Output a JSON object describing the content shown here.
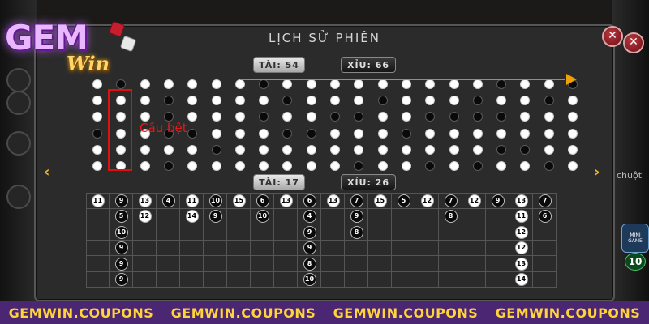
{
  "brand": {
    "logo_main": "GEM",
    "logo_sub": "Win"
  },
  "panel": {
    "title": "LỊCH SỬ PHIÊN",
    "close_label": "✕",
    "top_counts": {
      "tai_label": "TÀI:",
      "tai_value": "54",
      "xiu_label": "XỈU:",
      "xiu_value": "66"
    },
    "bottom_counts": {
      "tai_label": "TÀI:",
      "tai_value": "17",
      "xiu_label": "XỈU:",
      "xiu_value": "26"
    },
    "nav_prev": "‹",
    "nav_next": "›",
    "annotation": "Cầu bệt"
  },
  "dot_columns": [
    [
      "w",
      "w",
      "w",
      "b",
      "w",
      "w"
    ],
    [
      "b",
      "w",
      "w",
      "w",
      "w",
      "w"
    ],
    [
      "w",
      "w",
      "w",
      "w",
      "w",
      "w"
    ],
    [
      "w",
      "b",
      "b",
      "b",
      "w",
      "b"
    ],
    [
      "w",
      "w",
      "w",
      "b",
      "w",
      "w"
    ],
    [
      "w",
      "w",
      "w",
      "w",
      "b",
      "w"
    ],
    [
      "w",
      "w",
      "w",
      "w",
      "w",
      "w"
    ],
    [
      "b",
      "w",
      "b",
      "w",
      "w",
      "w"
    ],
    [
      "w",
      "b",
      "w",
      "b",
      "w",
      "w"
    ],
    [
      "w",
      "w",
      "w",
      "b",
      "w",
      "w"
    ],
    [
      "w",
      "w",
      "b",
      "w",
      "w",
      "w"
    ],
    [
      "w",
      "w",
      "b",
      "w",
      "w",
      "b"
    ],
    [
      "w",
      "b",
      "w",
      "w",
      "w",
      "w"
    ],
    [
      "w",
      "w",
      "w",
      "b",
      "w",
      "w"
    ],
    [
      "w",
      "w",
      "b",
      "w",
      "w",
      "b"
    ],
    [
      "w",
      "w",
      "b",
      "w",
      "w",
      "w"
    ],
    [
      "w",
      "b",
      "b",
      "w",
      "w",
      "b"
    ],
    [
      "b",
      "w",
      "b",
      "w",
      "b",
      "w"
    ],
    [
      "w",
      "w",
      "w",
      "w",
      "b",
      "w"
    ],
    [
      "w",
      "b",
      "w",
      "w",
      "w",
      "b"
    ],
    [
      "b",
      "w",
      "w",
      "w",
      "w",
      "w"
    ]
  ],
  "number_columns": [
    [
      {
        "v": "11",
        "c": "w"
      }
    ],
    [
      {
        "v": "9",
        "c": "b"
      },
      {
        "v": "5",
        "c": "b"
      },
      {
        "v": "10",
        "c": "b"
      },
      {
        "v": "9",
        "c": "b"
      },
      {
        "v": "9",
        "c": "b"
      },
      {
        "v": "9",
        "c": "b"
      }
    ],
    [
      {
        "v": "13",
        "c": "w"
      },
      {
        "v": "12",
        "c": "w"
      }
    ],
    [
      {
        "v": "4",
        "c": "b"
      }
    ],
    [
      {
        "v": "11",
        "c": "w"
      },
      {
        "v": "14",
        "c": "w"
      }
    ],
    [
      {
        "v": "10",
        "c": "b"
      },
      {
        "v": "9",
        "c": "b"
      }
    ],
    [
      {
        "v": "15",
        "c": "w"
      }
    ],
    [
      {
        "v": "6",
        "c": "b"
      },
      {
        "v": "10",
        "c": "b"
      }
    ],
    [
      {
        "v": "13",
        "c": "w"
      }
    ],
    [
      {
        "v": "6",
        "c": "b"
      },
      {
        "v": "4",
        "c": "b"
      },
      {
        "v": "9",
        "c": "b"
      },
      {
        "v": "9",
        "c": "b"
      },
      {
        "v": "8",
        "c": "b"
      },
      {
        "v": "10",
        "c": "b"
      }
    ],
    [
      {
        "v": "13",
        "c": "w"
      }
    ],
    [
      {
        "v": "7",
        "c": "b"
      },
      {
        "v": "9",
        "c": "b"
      },
      {
        "v": "8",
        "c": "b"
      }
    ],
    [
      {
        "v": "15",
        "c": "w"
      }
    ],
    [
      {
        "v": "5",
        "c": "b"
      }
    ],
    [
      {
        "v": "12",
        "c": "w"
      }
    ],
    [
      {
        "v": "7",
        "c": "b"
      },
      {
        "v": "8",
        "c": "b"
      }
    ],
    [
      {
        "v": "12",
        "c": "w"
      }
    ],
    [
      {
        "v": "9",
        "c": "b"
      }
    ],
    [
      {
        "v": "13",
        "c": "w"
      },
      {
        "v": "11",
        "c": "w"
      },
      {
        "v": "12",
        "c": "w"
      },
      {
        "v": "12",
        "c": "w"
      },
      {
        "v": "13",
        "c": "w"
      },
      {
        "v": "14",
        "c": "w"
      }
    ],
    [
      {
        "v": "7",
        "c": "b"
      },
      {
        "v": "6",
        "c": "b"
      }
    ]
  ],
  "side_text": "chuột",
  "mini_game": {
    "label": "MINI GAME",
    "count": "10"
  },
  "footer": [
    "GEMWIN.COUPONS",
    "GEMWIN.COUPONS",
    "GEMWIN.COUPONS",
    "GEMWIN.COUPONS"
  ],
  "colors": {
    "accent": "#f0a10a",
    "footer_bg": "#4b2672",
    "footer_text": "#ffd33a",
    "highlight": "#e01010"
  }
}
